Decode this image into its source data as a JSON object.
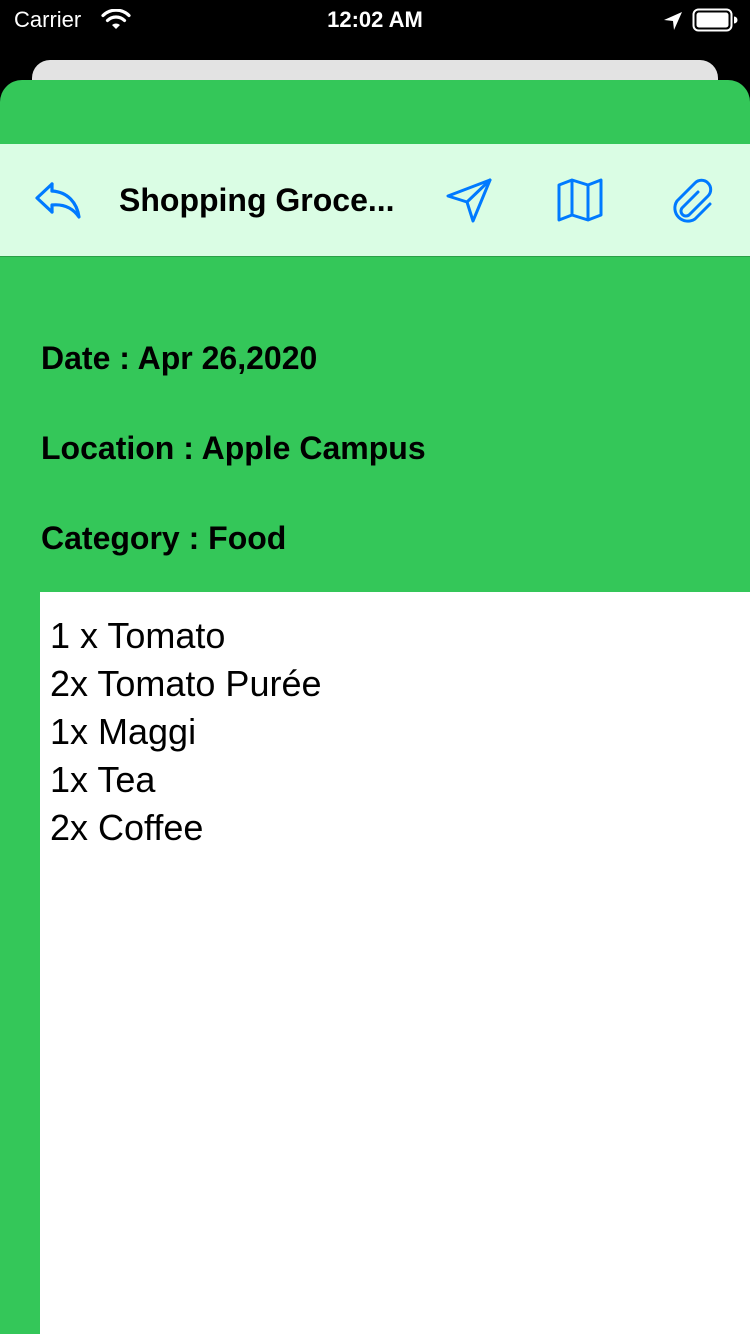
{
  "status_bar": {
    "carrier": "Carrier",
    "time": "12:02 AM"
  },
  "toolbar": {
    "title": "Shopping Groce...",
    "icons": [
      "reply-icon",
      "send-icon",
      "map-icon",
      "paperclip-icon"
    ]
  },
  "details": {
    "date": "Date : Apr 26,2020",
    "location": "Location : Apple Campus",
    "category": "Category : Food"
  },
  "notes": {
    "lines": [
      "1 x Tomato",
      "2x Tomato Purée",
      "1x Maggi",
      "1x Tea",
      "2x Coffee"
    ]
  },
  "colors": {
    "accent_green": "#34c759",
    "toolbar_background": "#dafde4",
    "icon_blue": "#007aff"
  }
}
